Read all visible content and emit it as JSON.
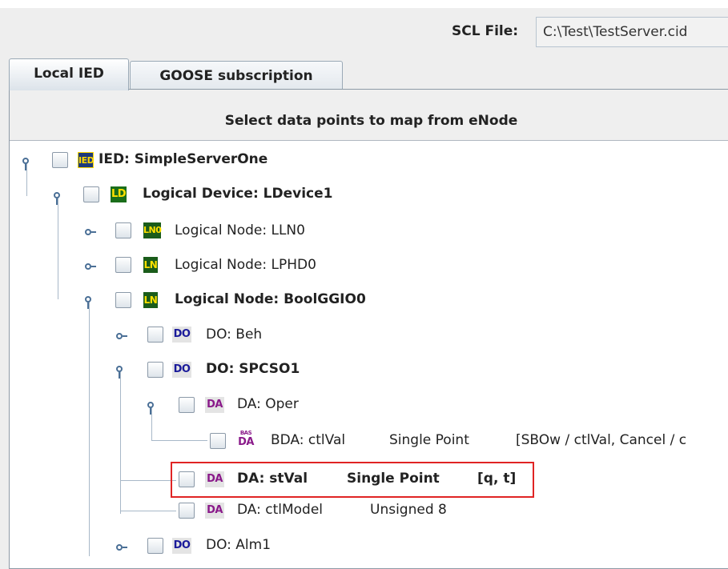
{
  "scl": {
    "label": "SCL File:",
    "path": "C:\\Test\\TestServer.cid"
  },
  "tabs": [
    {
      "label": "Local IED",
      "active": true
    },
    {
      "label": "GOOSE subscription",
      "active": false
    }
  ],
  "panel": {
    "header": "Select data points to map from eNode"
  },
  "tree": {
    "nodes": [
      {
        "icon": "IED",
        "label": "IED: SimpleServerOne",
        "bold": true
      },
      {
        "icon": "LD",
        "label": "Logical Device: LDevice1",
        "bold": true
      },
      {
        "icon": "LN0",
        "label": "Logical Node: LLN0",
        "bold": false
      },
      {
        "icon": "LN",
        "label": "Logical Node: LPHD0",
        "bold": false
      },
      {
        "icon": "LN",
        "label": "Logical Node: BoolGGIO0",
        "bold": true
      },
      {
        "icon": "DO",
        "label": "DO: Beh",
        "bold": false
      },
      {
        "icon": "DO",
        "label": "DO: SPCSO1",
        "bold": true
      },
      {
        "icon": "DA",
        "label": "DA: Oper",
        "bold": false
      },
      {
        "icon": "DA",
        "icon_small": "BAS",
        "label": "BDA: ctlVal",
        "type": "Single Point",
        "fc": "[SBOw / ctlVal, Cancel / c",
        "bold": false
      },
      {
        "icon": "DA",
        "label": "DA: stVal",
        "type": "Single Point",
        "fc": "[q, t]",
        "bold": true,
        "highlighted": true
      },
      {
        "icon": "DA",
        "label": "DA: ctlModel",
        "type": "Unsigned 8",
        "bold": false
      },
      {
        "icon": "DO",
        "label": "DO: Alm1",
        "bold": false
      }
    ]
  },
  "colors": {
    "highlight": "#e02424",
    "handle": "#4a6f96",
    "ied_bg": "#1e3a7a",
    "ln_bg": "#1a5c1a",
    "do_text": "#1a1a9a",
    "da_text": "#8a1a8a"
  }
}
